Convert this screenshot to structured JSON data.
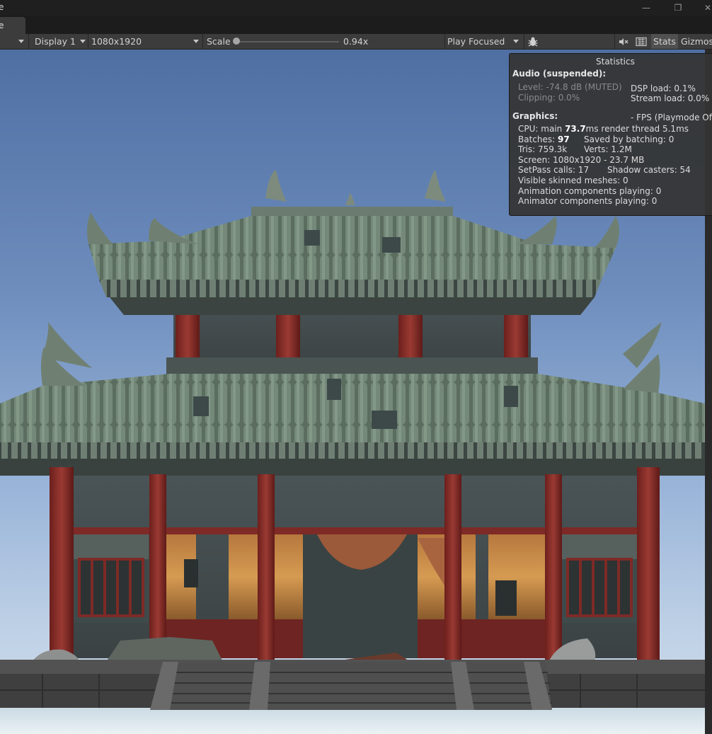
{
  "window": {
    "title_fragment": "e",
    "buttons": [
      "—",
      "❐",
      "✕"
    ]
  },
  "tab": {
    "label": "e"
  },
  "toolbar": {
    "display": "Display 1",
    "resolution": "1080x1920",
    "scale_label": "Scale",
    "scale_value": "0.94x",
    "scale_fraction": 0.0,
    "play_mode": "Play Focused",
    "stats": "Stats",
    "gizmos": "Gizmos"
  },
  "icons": [
    "bug-icon",
    "mute-audio-icon",
    "keyboard-icon",
    "chevron-down-icon"
  ],
  "stats": {
    "title": "Statistics",
    "audio_heading": "Audio (suspended):",
    "audio_level": "Level: -74.8 dB (MUTED)",
    "audio_clipping": "Clipping: 0.0%",
    "dsp_load": "DSP load: 0.1%",
    "stream_load": "Stream load: 0.0%",
    "graphics_heading": "Graphics:",
    "fps": "- FPS (Playmode Off)",
    "cpu_prefix": "CPU: main ",
    "cpu_main": "73.7",
    "cpu_suffix": "ms  render thread 5.1ms",
    "batches_prefix": "Batches: ",
    "batches": "97",
    "saved_batching": "Saved by batching: 0",
    "tris": "Tris: 759.3k",
    "verts": "Verts: 1.2M",
    "screen": "Screen: 1080x1920 - 23.7 MB",
    "setpass": "SetPass calls: 17",
    "shadow_casters": "Shadow casters: 54",
    "skinned": "Visible skinned meshes: 0",
    "animation": "Animation components playing: 0",
    "animator": "Animator components playing: 0"
  },
  "colors": {
    "toolbar_bg": "#3c3c3c",
    "sky_top": "#4f6fa3",
    "sky_bottom": "#d2e0ee",
    "roof_tile": "#66796a",
    "pillar_red": "#8a2c28",
    "wall": "#414a4c",
    "stone": "#454545"
  }
}
